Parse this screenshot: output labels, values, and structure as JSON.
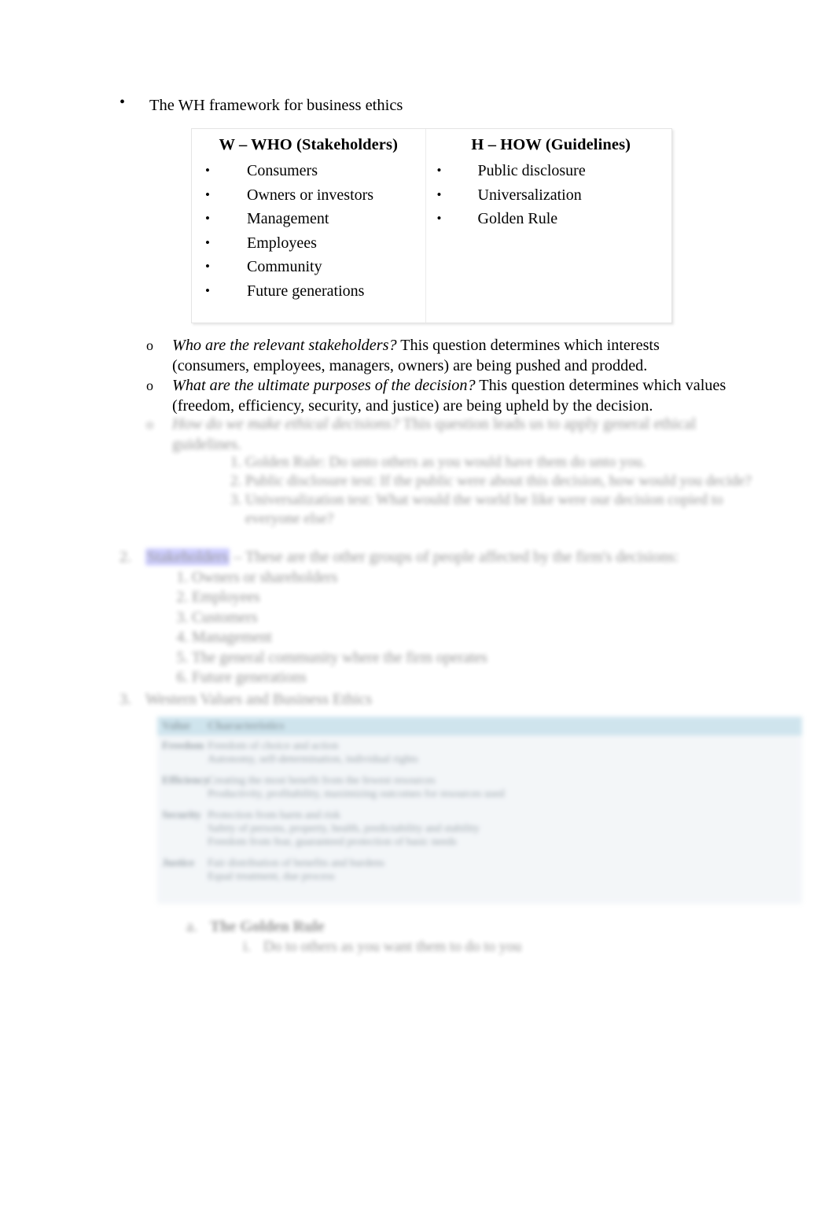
{
  "document": {
    "top_bullet": "The WH framework for business ethics"
  },
  "wh_table": {
    "columns": [
      {
        "header": "W – WHO (Stakeholders)",
        "items": [
          "Consumers",
          "Owners or investors",
          "Management",
          "Employees",
          "Community",
          "Future generations"
        ]
      },
      {
        "header": "H – HOW  (Guidelines)",
        "items": [
          "Public disclosure",
          "Universalization",
          "Golden Rule"
        ]
      }
    ]
  },
  "questions": [
    {
      "marker": "o",
      "emphasis": "Who are the relevant stakeholders?",
      "rest": " This question determines which interests (consumers, employees, managers, owners) are being pushed and prodded."
    },
    {
      "marker": "o",
      "emphasis": "What are the ultimate purposes of the decision?",
      "rest": " This question determines which values (freedom, efficiency, security, and justice) are being upheld by the decision."
    }
  ],
  "faded": {
    "question_three": {
      "marker": "o",
      "emphasis": "How do we make ethical decisions?",
      "rest": " This question leads us to apply general ethical guidelines."
    },
    "guideline_list": [
      "Golden Rule: Do unto others as you would have them do unto you.",
      "Public disclosure test: If the public were about this decision, how would you decide?",
      "Universalization test: What would the world be like were our decision copied to everyone else?"
    ],
    "stakeholders_block": {
      "number": "2.",
      "highlighted": "Stakeholders",
      "rest": " – These are the other groups of people affected by the firm's decisions:",
      "items": [
        "Owners or shareholders",
        "Employees",
        "Customers",
        "Management",
        "The general community where the firm operates",
        "Future generations"
      ]
    },
    "section_heading": {
      "number": "3.",
      "text": "Western Values and Business Ethics"
    },
    "golden_rule": {
      "marker": "a.",
      "heading": "The Golden Rule",
      "sub_marker": "i.",
      "sub_text": "Do to others as you want them to do to you"
    }
  },
  "blue_table": {
    "header": {
      "col1": "Value",
      "col2": "Characteristics"
    },
    "rows": [
      {
        "col1": "Freedom",
        "lines": [
          "Freedom of choice and action",
          "Autonomy, self-determination, individual rights"
        ]
      },
      {
        "col1": "Efficiency",
        "lines": [
          "Creating the most benefit from the fewest resources",
          "Productivity, profitability, maximizing outcomes for resources used"
        ]
      },
      {
        "col1": "Security",
        "lines": [
          "Protection from harm and risk",
          "Safety of persons, property, health, predictability and stability",
          "Freedom from fear, guaranteed protection of basic needs"
        ]
      },
      {
        "col1": "Justice",
        "lines": [
          "Fair distribution of benefits and burdens",
          "Equal treatment, due process"
        ]
      }
    ],
    "colors": {
      "header_bg": "#a9cfe0",
      "body_bg": "#eaeff4",
      "header_text": "#3e5a66",
      "body_text": "#4a5b66"
    }
  },
  "colors": {
    "highlight": "#9a9aff",
    "page_bg": "#ffffff",
    "text": "#000000"
  }
}
